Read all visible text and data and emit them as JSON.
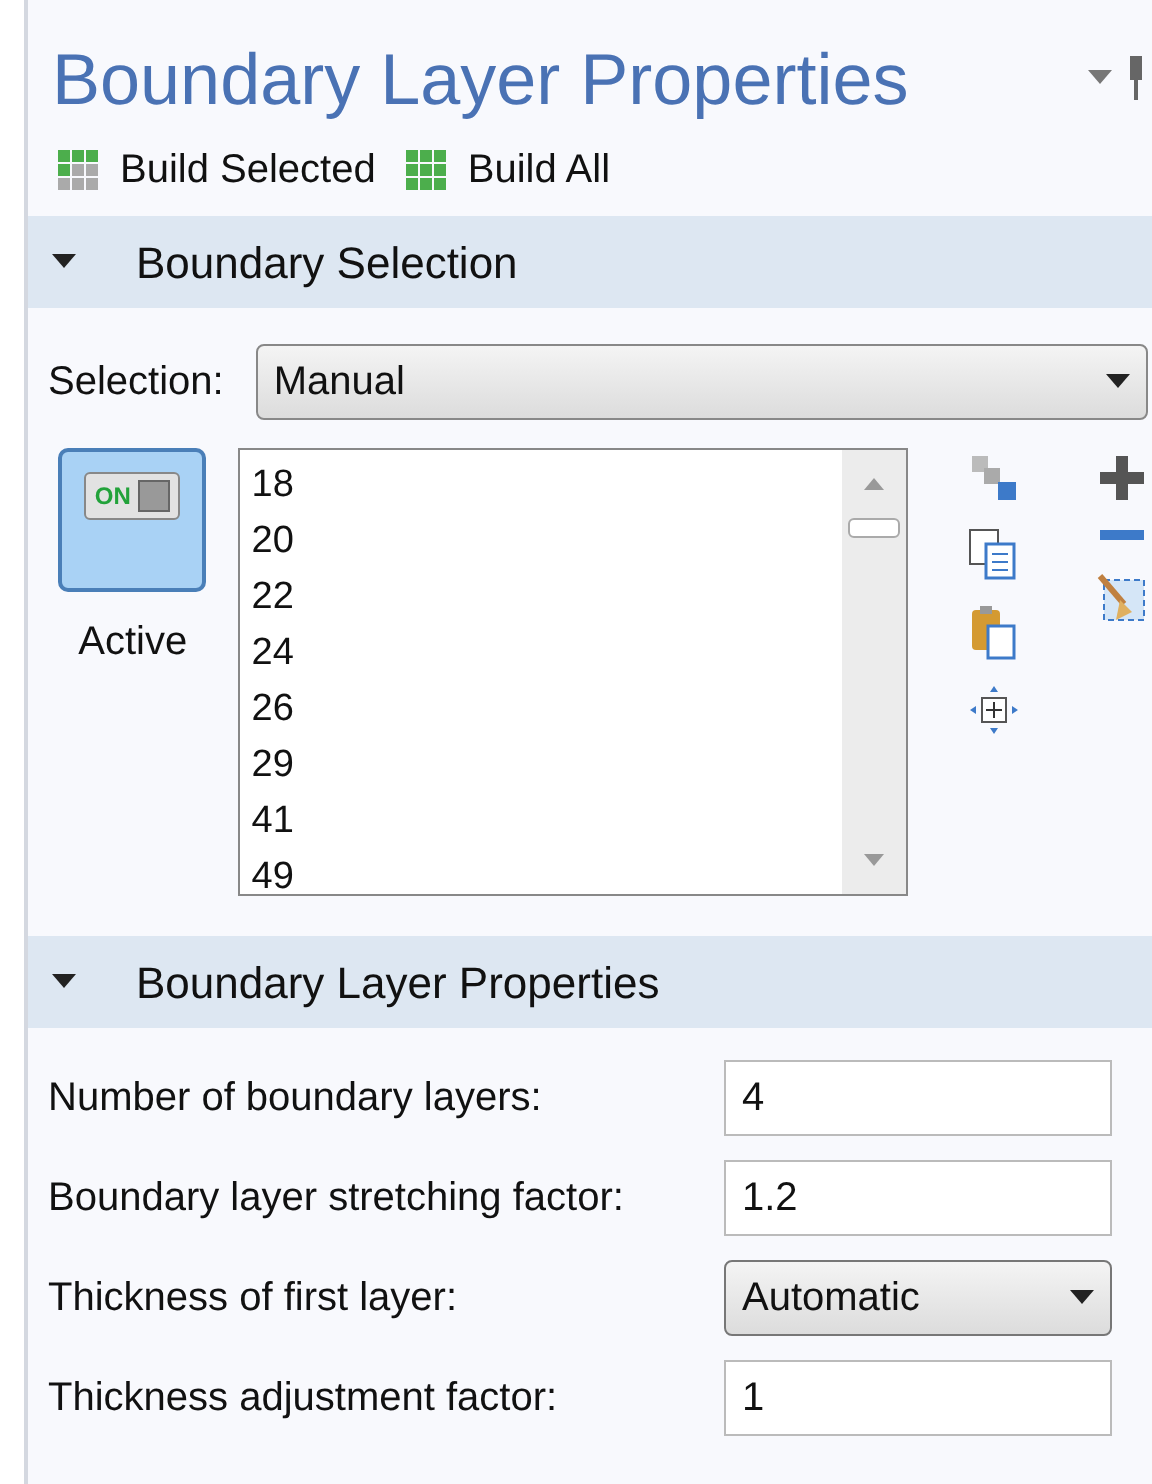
{
  "title": "Boundary Layer Properties",
  "toolbar": [
    {
      "label": "Build Selected",
      "kind": "selected"
    },
    {
      "label": "Build All",
      "kind": "all"
    }
  ],
  "sections": [
    {
      "title": "Boundary Selection",
      "expanded": true
    },
    {
      "title": "Boundary Layer Properties",
      "expanded": true
    }
  ],
  "selection": {
    "label": "Selection:",
    "value": "Manual",
    "active": {
      "label": "Active",
      "badge": "ON",
      "on": true
    },
    "items": [
      "18",
      "20",
      "22",
      "24",
      "26",
      "29",
      "41",
      "49"
    ]
  },
  "fields": [
    {
      "kind": "text",
      "label": "Number of boundary layers:",
      "value": "4"
    },
    {
      "kind": "text",
      "label": "Boundary layer stretching factor:",
      "value": "1.2"
    },
    {
      "kind": "dropdown",
      "label": "Thickness of first layer:",
      "value": "Automatic"
    },
    {
      "kind": "text",
      "label": "Thickness adjustment factor:",
      "value": "1"
    }
  ]
}
